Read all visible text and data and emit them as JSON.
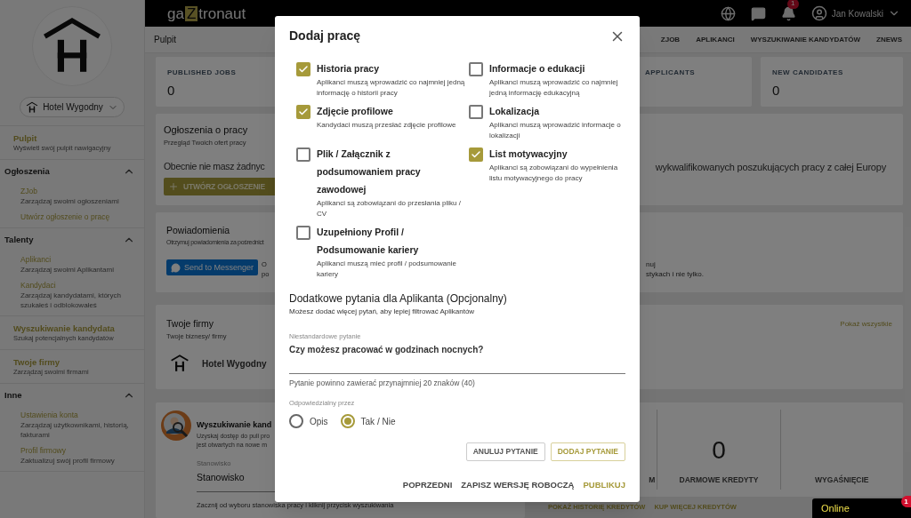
{
  "sidebar": {
    "company": "Hotel Wygodny",
    "items": [
      {
        "kind": "link",
        "label": "Pulpit",
        "description": "Wyświetl swój pulpit nawigacyjny"
      },
      {
        "kind": "section",
        "label": "Ogłoszenia",
        "expanded": true,
        "children": [
          {
            "label": "ZJob",
            "description": "Zarządzaj swoimi ogłoszeniami"
          },
          {
            "label": "Utwórz ogłoszenie o pracę"
          }
        ]
      },
      {
        "kind": "section",
        "label": "Talenty",
        "expanded": true,
        "children": [
          {
            "label": "Aplikanci",
            "description": "Zarządzaj swoimi Aplikantami"
          },
          {
            "label": "Kandydaci",
            "description": "Zarządzaj kandydatami, których szukałeś i odblokowałeś"
          }
        ]
      },
      {
        "kind": "link",
        "label": "Wyszukiwanie kandydata",
        "description": "Szukaj potencjalnych kandydatów"
      },
      {
        "kind": "link",
        "label": "Twoje firmy",
        "description": "Zarządzaj swoimi firmami"
      },
      {
        "kind": "section",
        "label": "Inne",
        "expanded": true,
        "children": [
          {
            "label": "Ustawienia konta",
            "description": "Zarządzaj użytkownikami, historią, fakturami"
          },
          {
            "label": "Profil firmowy",
            "description": "Zaktualizuj swój profil firmowy"
          }
        ]
      }
    ]
  },
  "top_bar": {
    "logo": {
      "before": "ga",
      "highlight": "Z",
      "after": "tronaut"
    },
    "notifications": "1",
    "user": "Jan Kowalski"
  },
  "sub_nav": {
    "page": "Pulpit",
    "tabs": [
      "ZJOB",
      "APLIKANCI",
      "WYSZUKIWANIE KANDYDATÓW",
      "ZNEWS"
    ]
  },
  "stats": [
    {
      "label": "PUBLISHED JOBS",
      "value": "0"
    },
    {
      "label": "APPLICANTS"
    },
    {
      "label": "NEW CANDIDATES",
      "value": "0"
    }
  ],
  "job_ads": {
    "title": "Ogłoszenia o pracy",
    "subtitle": "Przegląd Twoich ofert pracy",
    "empty_text": "Obecnie nie masz żadnyc",
    "right_text": "wykwalifikowanych poszukujących pracy z całej Europy",
    "create_button": "UTWÓRZ OGŁOSZENIE"
  },
  "notifications": {
    "title": "Powiadomienia",
    "subtitle": "Otrzymuj powiadomienia za pośrednict",
    "messenger_button": "Send to Messenger",
    "left_lines": [
      "O",
      "po"
    ],
    "right_lines": [
      "nuj",
      "stykach i nie tylko."
    ]
  },
  "companies": {
    "title": "Twoje firmy",
    "subtitle": "Twoje biznesy/ firmy",
    "show_all": "Pokaż wszystkie",
    "items": [
      "Hotel Wygodny"
    ]
  },
  "candidate_search": {
    "title": "Wyszukiwanie kand",
    "description_lines": [
      "Uzyskaj dostęp do puli pro",
      "jest otwartych na nowe m"
    ],
    "field": {
      "label": "Stanowisko",
      "value": "Stanowisko"
    },
    "hint": "Zacznij od wyboru stanowiska pracy i kliknij przycisk wyszukiwania"
  },
  "credits": {
    "columns": [
      {
        "label": "M"
      },
      {
        "value": "0",
        "label": "DARMOWE KREDYTY"
      },
      {
        "label": "WYGAŚNIĘCIE"
      }
    ],
    "links": [
      "POKAŻ HISTORIĘ KREDYTÓW",
      "KUP WIĘCEJ KREDYTÓW"
    ]
  },
  "chat": {
    "label": "Online",
    "badge": "1"
  },
  "modal": {
    "title": "Dodaj pracę",
    "requirements": [
      {
        "label": "Historia pracy",
        "description": "Aplikanci muszą wprowadzić co najmniej jedną informację o historii pracy",
        "checked": true
      },
      {
        "label": "Informacje o edukacji",
        "description": "Aplikanci muszą wprowadzić co najmniej jedną informację edukacyjną",
        "checked": false
      },
      {
        "label": "Zdjęcie profilowe",
        "description": "Kandydaci muszą przesłać zdjęcie profilowe",
        "checked": true
      },
      {
        "label": "Lokalizacja",
        "description": "Aplikanci muszą wprowadzić informacje o lokalizacji",
        "checked": false
      },
      {
        "label": "Plik / Załącznik z podsumowaniem pracy zawodowej",
        "description": "Aplikanci są zobowiązani do przesłania pliku / CV",
        "checked": false
      },
      {
        "label": "List motywacyjny",
        "description": "Aplikanci są zobowiązani do wypełnienia listu motywacyjnego do pracy",
        "checked": true
      },
      {
        "label": "Uzupełniony Profil / Podsumowanie kariery",
        "description": "Aplikanci muszą mieć profil / podsumowanie kariery",
        "checked": false
      }
    ],
    "questions": {
      "title": "Dodatkowe pytania dla Aplikanta (Opcjonalny)",
      "subtitle": "Możesz dodać więcej pytań, aby lepiej filtrować Aplikantów",
      "field": {
        "label": "Niestandardowe pytanie",
        "value": "Czy możesz pracować w godzinach nocnych?",
        "helper": "Pytanie powinno zawierać przynajmniej 20 znaków (40)"
      },
      "answer_label": "Odpowiedzialny przez",
      "answer_options": [
        {
          "label": "Opis",
          "selected": false
        },
        {
          "label": "Tak / Nie",
          "selected": true
        }
      ],
      "buttons": [
        {
          "label": "ANULUJ PYTANIE",
          "kind": "outline"
        },
        {
          "label": "DODAJ PYTANIE",
          "kind": "primary"
        }
      ]
    },
    "footer_buttons": [
      {
        "label": "POPRZEDNI",
        "kind": "plain"
      },
      {
        "label": "ZAPISZ WERSJĘ ROBOCZĄ",
        "kind": "plain"
      },
      {
        "label": "PUBLIKUJ",
        "kind": "primary"
      }
    ]
  }
}
